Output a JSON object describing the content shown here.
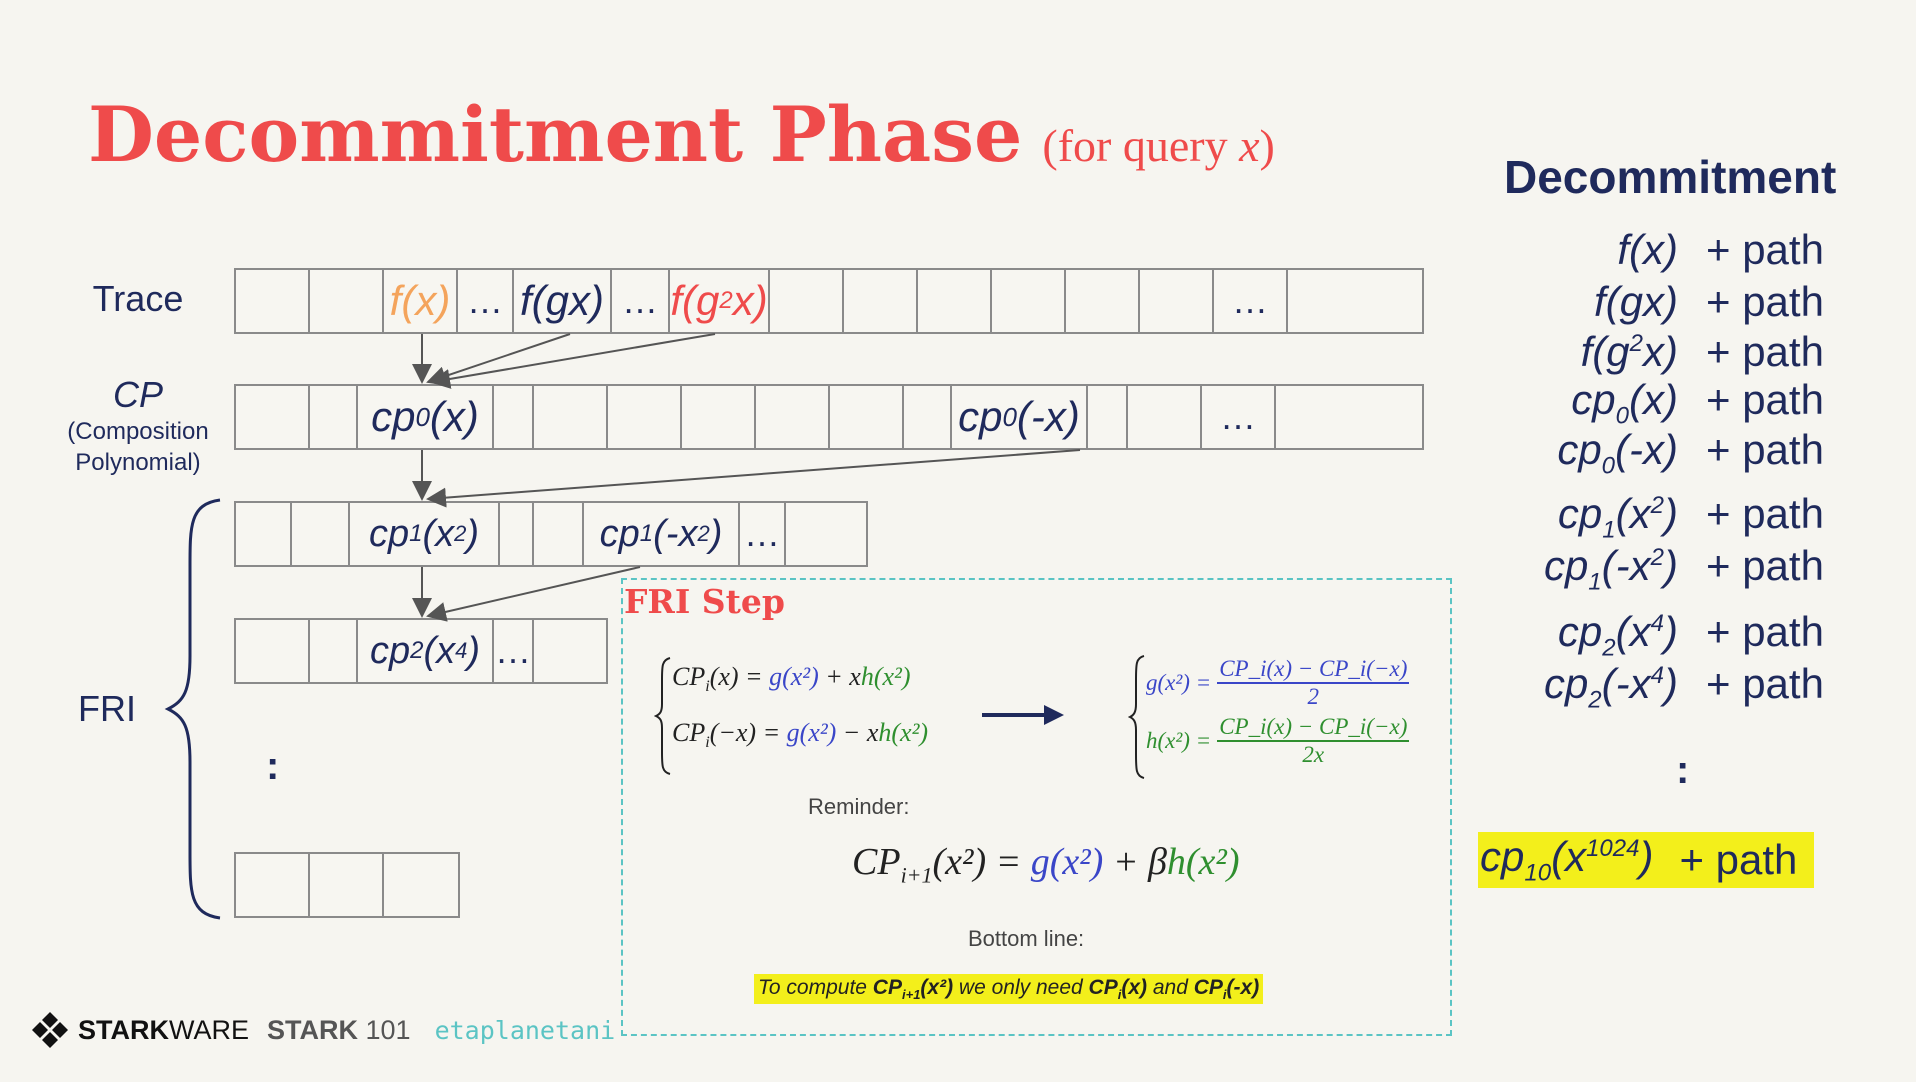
{
  "title": "Decommitment Phase",
  "subtitle_prefix": "(for query ",
  "subtitle_var": "x",
  "subtitle_suffix": ")",
  "labels": {
    "trace": "Trace",
    "cp": "CP",
    "cp_sub1": "(Composition",
    "cp_sub2": "Polynomial)",
    "fri": "FRI",
    "vdots": ":"
  },
  "trace_cells": {
    "fx": "f(x)",
    "dots1": "…",
    "fgx": "f(gx)",
    "dots2": "…",
    "fg2x_pre": "f(g",
    "fg2x_sup": "2",
    "fg2x_post": "x)",
    "dots3": "…"
  },
  "cp_cells": {
    "cp0x_base": "cp",
    "cp0x_sub": "0",
    "cp0x_arg": "(x)",
    "cp0mx_base": "cp",
    "cp0mx_sub": "0",
    "cp0mx_arg": "(-x)",
    "dots": "…"
  },
  "fri1_cells": {
    "a_base": "cp",
    "a_sub": "1",
    "a_pre": "(x",
    "a_sup": "2",
    "a_post": ")",
    "b_base": "cp",
    "b_sub": "1",
    "b_pre": "(-x",
    "b_sup": "2",
    "b_post": ")",
    "dots": "…"
  },
  "fri2_cells": {
    "a_base": "cp",
    "a_sub": "2",
    "a_pre": "(x",
    "a_sup": "4",
    "a_post": ")",
    "dots": "…"
  },
  "fri_step": {
    "title": "FRI Step",
    "eq1_lhs": "CP",
    "eq1_lhs_sub": "i",
    "eq1_lhs_arg": "(x) = ",
    "eq1_g": "g(x²)",
    "eq1_mid": " + x",
    "eq1_h": "h(x²)",
    "eq2_lhs_arg": "(−x) = ",
    "eq2_mid": " − x",
    "g_lhs": "g(x²) =",
    "g_num": "CP_i(x) − CP_i(−x)",
    "g_den": "2",
    "h_lhs": "h(x²) =",
    "h_num": "CP_i(x) − CP_i(−x)",
    "h_den": "2x",
    "reminder_label": "Reminder:",
    "rem_lhs": "CP",
    "rem_sub": "i+1",
    "rem_arg": "(x²) = ",
    "rem_g": "g(x²)",
    "rem_mid": " + β",
    "rem_h": "h(x²)",
    "bottom_label": "Bottom line:",
    "bl_1": "To compute ",
    "bl_cp1": "CP",
    "bl_cp1_sub": "i+1",
    "bl_cp1_arg": "(x²)",
    "bl_2": "  we only need ",
    "bl_cp2": "CP",
    "bl_cp2_sub": "i",
    "bl_cp2_arg": "(x)",
    "bl_3": "  and ",
    "bl_cp3": "CP",
    "bl_cp3_sub": "i",
    "bl_cp3_arg": "(-x)"
  },
  "decommitment": {
    "heading": "Decommitment",
    "path": "+ path",
    "rows": [
      {
        "base": "f(x)",
        "sub": "",
        "pre": "",
        "sup": "",
        "post": ""
      },
      {
        "base": "f(gx)",
        "sub": "",
        "pre": "",
        "sup": "",
        "post": ""
      },
      {
        "base": "f(g",
        "sub": "",
        "pre": "",
        "sup": "2",
        "post": "x)"
      },
      {
        "base": "cp",
        "sub": "0",
        "pre": "(x)",
        "sup": "",
        "post": ""
      },
      {
        "base": "cp",
        "sub": "0",
        "pre": "(-x)",
        "sup": "",
        "post": ""
      },
      {
        "base": "cp",
        "sub": "1",
        "pre": "(x",
        "sup": "2",
        "post": ")"
      },
      {
        "base": "cp",
        "sub": "1",
        "pre": "(-x",
        "sup": "2",
        "post": ")"
      },
      {
        "base": "cp",
        "sub": "2",
        "pre": "(x",
        "sup": "4",
        "post": ")"
      },
      {
        "base": "cp",
        "sub": "2",
        "pre": "(-x",
        "sup": "4",
        "post": ")"
      }
    ],
    "vdots": ":",
    "last_base": "cp",
    "last_sub": "10",
    "last_pre": "(x",
    "last_sup": "1024",
    "last_post": ")",
    "last_path": "+ path"
  },
  "footer": {
    "brand_bold": "STARK",
    "brand_light": "WARE",
    "course_bold": "STARK",
    "course_num": "101",
    "handle": "etaplanetani"
  },
  "colors": {
    "title": "#ef4b4b",
    "navy": "#1f2a5c",
    "highlight": "#f3ef1b",
    "fri_border": "#5bc4c4",
    "g_blue": "#3a46c8",
    "h_green": "#2f8f2f"
  }
}
